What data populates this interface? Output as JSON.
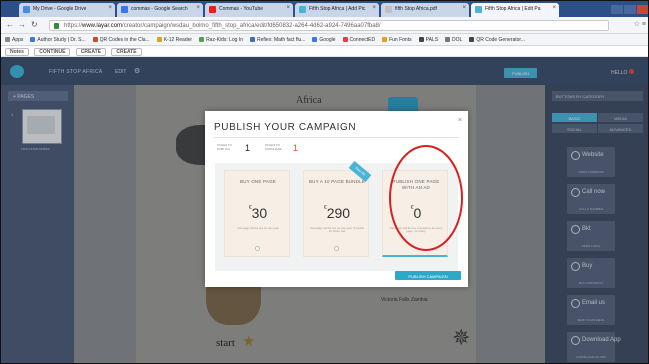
{
  "browser": {
    "tabs": [
      {
        "label": "My Drive - Google Drive",
        "color": "#4a8ae0"
      },
      {
        "label": "commas - Google Search",
        "color": "#3b78e7"
      },
      {
        "label": "Commas - YouTube",
        "color": "#e62117"
      },
      {
        "label": "Fifth Stop Africa | Add Pic",
        "color": "#49b4d6"
      },
      {
        "label": "fifth Stop Africa.pdf",
        "color": "#bfbfbf"
      },
      {
        "label": "Fifth Stop Africa | Edit Pa",
        "color": "#49b4d6"
      }
    ],
    "url_scheme": "https://",
    "url_host": "www.layar.com",
    "url_path": "/creator/campaign/wsdau_bolmo_fifth_stop_africa/edit/fd650832-a264-4d62-a924-7496aa07fba8/",
    "bookmarks": [
      {
        "label": "Apps",
        "color": "#888888"
      },
      {
        "label": "Author Study | Dr. S...",
        "color": "#3b78e7"
      },
      {
        "label": "QR Codes in the Cla...",
        "color": "#d04a2a"
      },
      {
        "label": "K-12 Reader",
        "color": "#e0a020"
      },
      {
        "label": "Raz-Kids: Log In",
        "color": "#58a050"
      },
      {
        "label": "Reflex: Math fact flu...",
        "color": "#4070b0"
      },
      {
        "label": "Google",
        "color": "#3b78e7"
      },
      {
        "label": "ConnectED",
        "color": "#e04040"
      },
      {
        "label": "Fun Fonts",
        "color": "#e0a020"
      },
      {
        "label": "PALS",
        "color": "#444444"
      },
      {
        "label": "DOL",
        "color": "#777777"
      },
      {
        "label": "QR Code Generator...",
        "color": "#444444"
      }
    ],
    "extensions": [
      "Notes",
      "CONTINUE",
      "CREATE",
      "CREATE"
    ]
  },
  "app": {
    "campaign_title": "FIFTH STOP AFRICA",
    "edit_label": "EDIT",
    "publish_label": "PUBLISH",
    "help_label": "HELLO"
  },
  "left": {
    "pages_label": "+ PAGES",
    "thumb_number": "1",
    "thumb_caption": "FIFTH STOP AFRICA"
  },
  "canvas": {
    "africa_label": "Africa",
    "start_label": "start",
    "victoria_label": "Victoria Falls Zambia"
  },
  "right": {
    "select_label": "BUTTONS BY CATEGORY",
    "tabs": [
      "BASIC",
      "MEDIA",
      "SOCIAL",
      "ADVANCED"
    ],
    "buttons": [
      {
        "label": "Website",
        "caption": "OPEN A WEBSITE"
      },
      {
        "label": "Call now",
        "caption": "CALL A NUMBER"
      },
      {
        "label": "Bkt",
        "caption": "OPEN A MAIL"
      },
      {
        "label": "Buy",
        "caption": "BUY A PRODUCT"
      },
      {
        "label": "Email us",
        "caption": "SEND YOUR EMAIL"
      },
      {
        "label": "Download App",
        "caption": "DOWNLOAD AN APP"
      }
    ]
  },
  "modal": {
    "title": "PUBLISH YOUR CAMPAIGN",
    "close": "×",
    "pages_to_publish_label": "PAGES TO PUBLISH",
    "pages_to_publish_value": "1",
    "pages_to_purchase_label": "PAGES TO PURCHASE",
    "pages_to_purchase_value": "1",
    "ribbon": "Save 0%",
    "options": [
      {
        "title": "BUY ONE PAGE",
        "currency": "€",
        "price": "30",
        "desc": "Campaign will be live for one year"
      },
      {
        "title": "BUY A 10 PAGE BUNDLE",
        "currency": "€",
        "price": "290",
        "desc": "Campaign will be live for one year. 9 credits for future use"
      },
      {
        "title": "PUBLISH ONE PAGE WITH AN AD",
        "currency": "€",
        "price": "0",
        "desc": "Campaign will be free if ad tied to an every page, no expiry"
      }
    ],
    "publish_button": "PUBLISH CAMPAIGN"
  },
  "annotation_color": "#d8201e"
}
